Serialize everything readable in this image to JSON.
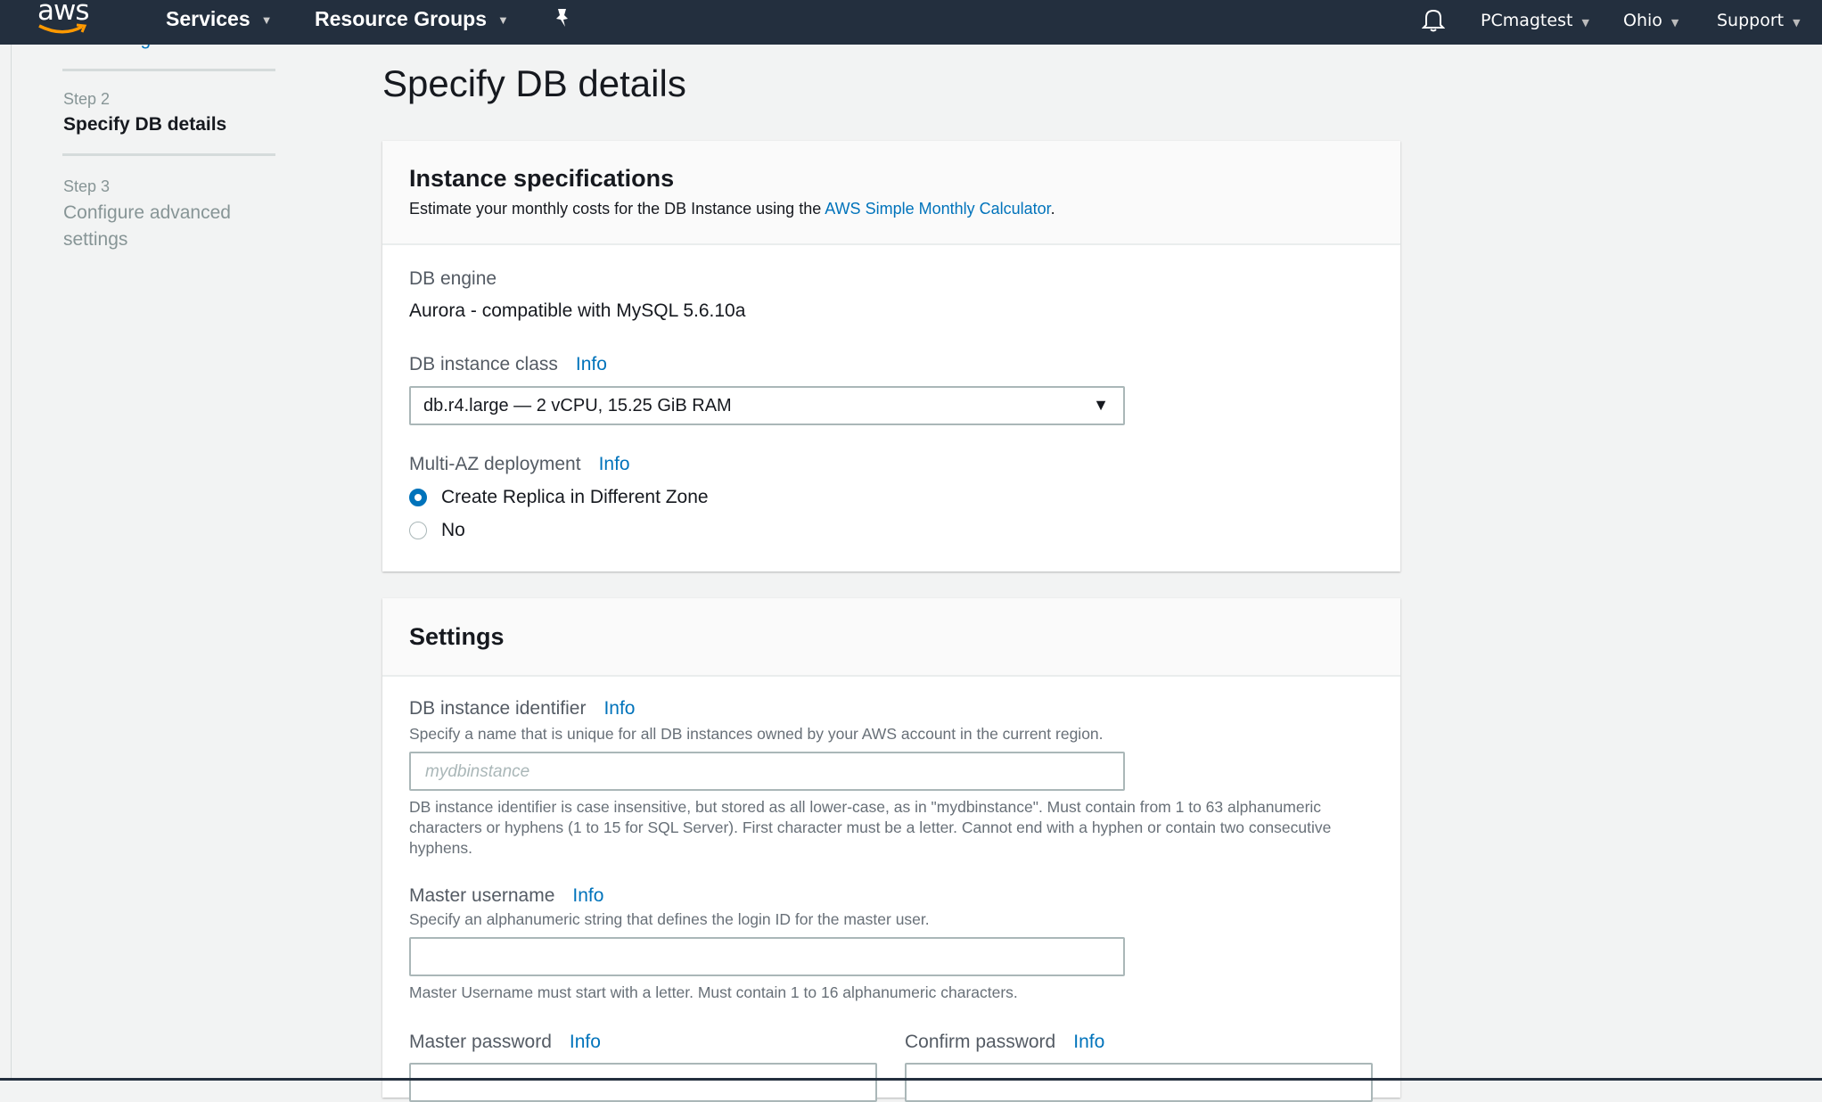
{
  "topbar": {
    "logo_text": "aws",
    "services": "Services",
    "resource_groups": "Resource Groups",
    "account": "PCmagtest",
    "region": "Ohio",
    "support": "Support",
    "icons": [
      "pin-icon",
      "bell-icon",
      "caret-down-icon"
    ]
  },
  "sidebar": {
    "step1_label": "Select engine",
    "step2_num": "Step 2",
    "step2_label": "Specify DB details",
    "step3_num": "Step 3",
    "step3_label": "Configure advanced settings"
  },
  "page_title": "Specify DB details",
  "instance_specs": {
    "title": "Instance specifications",
    "subtitle_prefix": "Estimate your monthly costs for the DB Instance using the ",
    "calculator_link": "AWS Simple Monthly Calculator",
    "subtitle_suffix": ".",
    "db_engine_label": "DB engine",
    "db_engine_value": "Aurora - compatible with MySQL 5.6.10a",
    "instance_class_label": "DB instance class",
    "instance_class_value": "db.r4.large — 2 vCPU, 15.25 GiB RAM",
    "multi_az_label": "Multi-AZ deployment",
    "multi_az_options": [
      {
        "label": "Create Replica in Different Zone",
        "selected": true
      },
      {
        "label": "No",
        "selected": false
      }
    ],
    "info": "Info"
  },
  "settings": {
    "title": "Settings",
    "identifier_label": "DB instance identifier",
    "identifier_help": "Specify a name that is unique for all DB instances owned by your AWS account in the current region.",
    "identifier_placeholder": "mydbinstance",
    "identifier_value": "",
    "identifier_constraints": "DB instance identifier is case insensitive, but stored as all lower-case, as in \"mydbinstance\". Must contain from 1 to 63 alphanumeric characters or hyphens (1 to 15 for SQL Server). First character must be a letter. Cannot end with a hyphen or contain two consecutive hyphens.",
    "username_label": "Master username",
    "username_help": "Specify an alphanumeric string that defines the login ID for the master user.",
    "username_value": "",
    "username_constraints": "Master Username must start with a letter. Must contain 1 to 16 alphanumeric characters.",
    "password_label": "Master password",
    "confirm_label": "Confirm password",
    "info": "Info"
  },
  "colors": {
    "topbar": "#232f3e",
    "link": "#0073bb",
    "accent": "#ff9900",
    "background": "#f2f3f3"
  }
}
